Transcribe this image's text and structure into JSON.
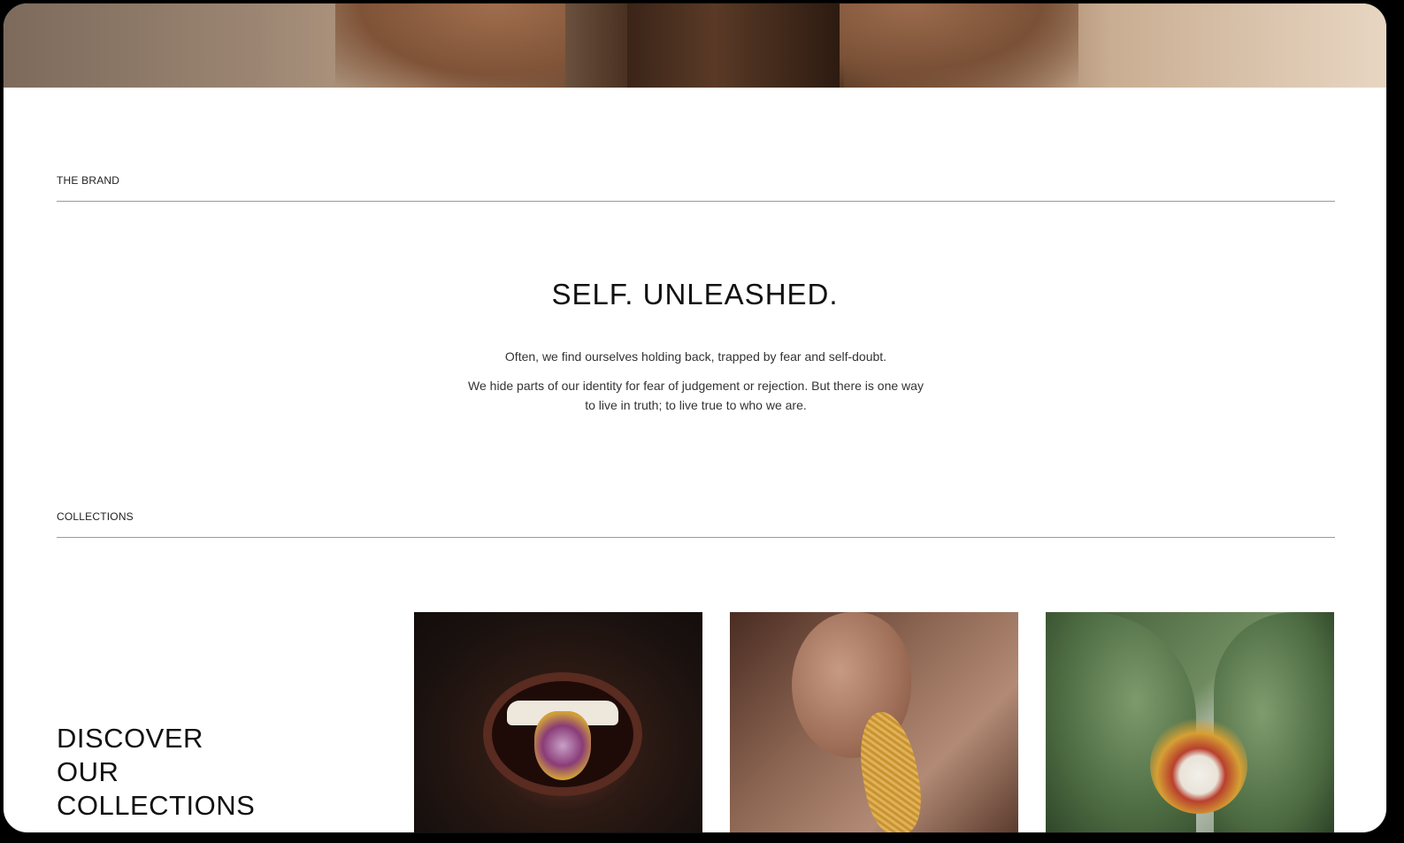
{
  "brand_section": {
    "label": "THE BRAND",
    "headline": "SELF. UNLEASHED.",
    "paragraphs": [
      "Often, we find ourselves holding back, trapped by fear and self-doubt.",
      "We hide parts of our identity for fear of judgement or rejection. But there is one way to live in truth; to live true to who we are."
    ]
  },
  "collections_section": {
    "label": "COLLECTIONS",
    "heading_lines": [
      "DISCOVER",
      "OUR",
      "COLLECTIONS"
    ],
    "cards": [
      {
        "image": "mouth-grill-jewelry-photo"
      },
      {
        "image": "ear-gold-earring-photo"
      },
      {
        "image": "cactus-gold-brooch-photo"
      }
    ]
  },
  "colors": {
    "background": "#ffffff",
    "text": "#111111",
    "rule": "#9a9a9a"
  }
}
